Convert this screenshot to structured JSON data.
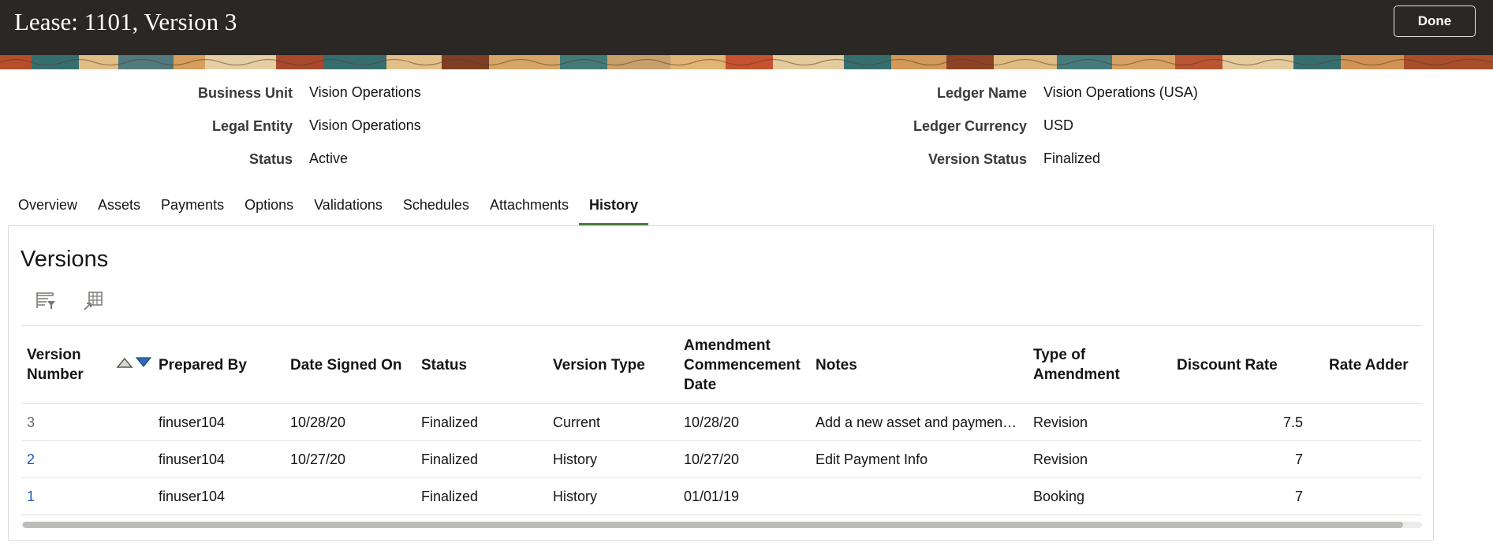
{
  "header": {
    "title": "Lease: 1101, Version 3",
    "done_label": "Done"
  },
  "fields": {
    "business_unit": {
      "label": "Business Unit",
      "value": "Vision Operations"
    },
    "legal_entity": {
      "label": "Legal Entity",
      "value": "Vision Operations"
    },
    "status": {
      "label": "Status",
      "value": "Active"
    },
    "ledger_name": {
      "label": "Ledger Name",
      "value": "Vision Operations (USA)"
    },
    "ledger_currency": {
      "label": "Ledger Currency",
      "value": "USD"
    },
    "version_status": {
      "label": "Version Status",
      "value": "Finalized"
    }
  },
  "tabs": [
    {
      "label": "Overview"
    },
    {
      "label": "Assets"
    },
    {
      "label": "Payments"
    },
    {
      "label": "Options"
    },
    {
      "label": "Validations"
    },
    {
      "label": "Schedules"
    },
    {
      "label": "Attachments"
    },
    {
      "label": "History",
      "active": true
    }
  ],
  "versions": {
    "title": "Versions",
    "toolbar": [
      "query-by-example-icon",
      "detach-table-icon"
    ],
    "columns": {
      "version_number_l1": "Version",
      "version_number_l2": "Number",
      "prepared_by": "Prepared By",
      "date_signed_on": "Date Signed On",
      "status": "Status",
      "version_type": "Version Type",
      "amendment_l1": "Amendment",
      "amendment_l2": "Commencement",
      "amendment_l3": "Date",
      "notes": "Notes",
      "type_of_amendment_l1": "Type of",
      "type_of_amendment_l2": "Amendment",
      "discount_rate": "Discount Rate",
      "rate_adder": "Rate Adder"
    },
    "rows": [
      {
        "version_number": "3",
        "prepared_by": "finuser104",
        "date_signed_on": "10/28/20",
        "status": "Finalized",
        "version_type": "Current",
        "amendment_commencement_date": "10/28/20",
        "notes": "Add a new asset and payment info",
        "type_of_amendment": "Revision",
        "discount_rate": "7.5",
        "rate_adder": ""
      },
      {
        "version_number": "2",
        "prepared_by": "finuser104",
        "date_signed_on": "10/27/20",
        "status": "Finalized",
        "version_type": "History",
        "amendment_commencement_date": "10/27/20",
        "notes": "Edit Payment Info",
        "type_of_amendment": "Revision",
        "discount_rate": "7",
        "rate_adder": ""
      },
      {
        "version_number": "1",
        "prepared_by": "finuser104",
        "date_signed_on": "",
        "status": "Finalized",
        "version_type": "History",
        "amendment_commencement_date": "01/01/19",
        "notes": "",
        "type_of_amendment": "Booking",
        "discount_rate": "7",
        "rate_adder": ""
      }
    ]
  },
  "colors": {
    "header_bg": "#2b2724",
    "active_tab_underline": "#4b7d3f",
    "link": "#1a5bb5"
  }
}
